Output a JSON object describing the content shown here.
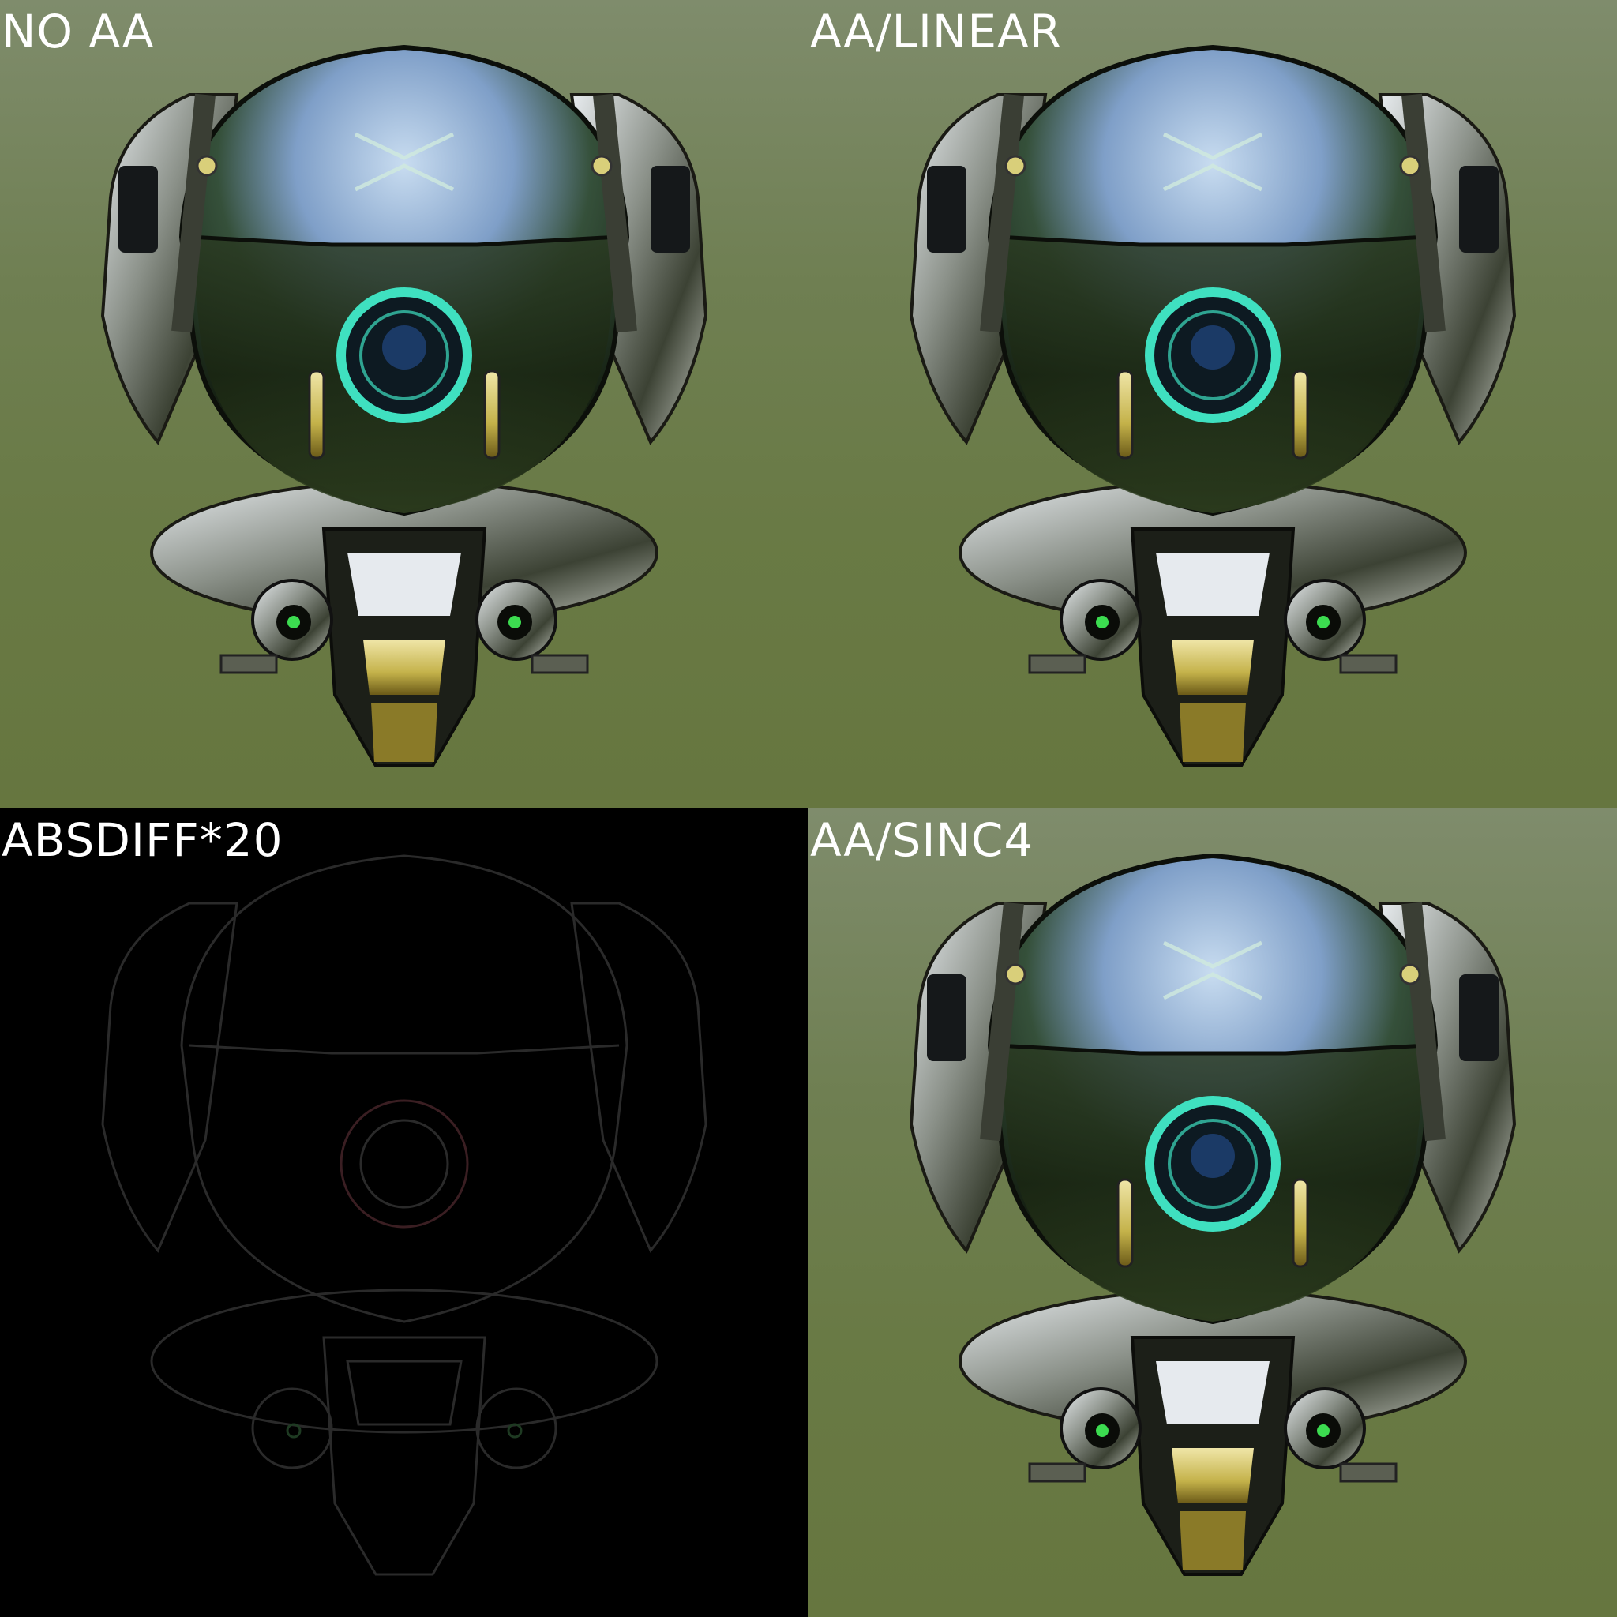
{
  "panels": [
    {
      "id": "tl",
      "label": "NO AA",
      "mode": "render",
      "colors": {
        "bg": "#6f7f52"
      }
    },
    {
      "id": "tr",
      "label": "AA/LINEAR",
      "mode": "render",
      "colors": {
        "bg": "#6f7f52"
      }
    },
    {
      "id": "bl",
      "label": "ABSDIFF*20",
      "mode": "diff",
      "colors": {
        "bg": "#000000"
      }
    },
    {
      "id": "br",
      "label": "AA/SINC4",
      "mode": "render",
      "colors": {
        "bg": "#6f7f52"
      }
    }
  ],
  "subject": {
    "icon": "helmet-render",
    "accent": "#3fe0c0",
    "visor_top": "#9fbfe0",
    "visor_bottom": "#1d2a14"
  }
}
